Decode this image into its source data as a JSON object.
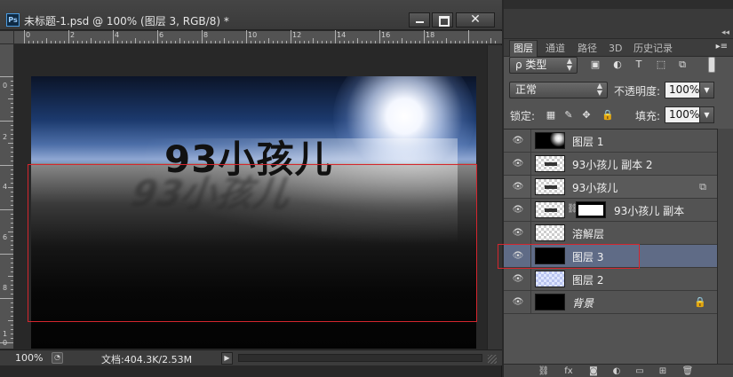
{
  "document": {
    "title": "未标题-1.psd @ 100% (图层 3, RGB/8) *",
    "app_badge": "Ps",
    "close_glyph": "✕",
    "zoom": "100%",
    "doc_info": "文档:404.3K/2.53M",
    "ruler_top_labels": [
      "0",
      "2",
      "4",
      "6",
      "8",
      "10",
      "12",
      "14",
      "16",
      "18"
    ],
    "ruler_left_labels": [
      "0",
      "2",
      "4",
      "6",
      "8",
      "1",
      "0"
    ],
    "canvas_text": "93小孩儿"
  },
  "panel": {
    "tabs": [
      {
        "label": "图层",
        "active": true
      },
      {
        "label": "通道",
        "active": false
      },
      {
        "label": "路径",
        "active": false
      },
      {
        "label": "3D",
        "active": false
      },
      {
        "label": "历史记录",
        "active": false
      }
    ],
    "filter_kind": "ρ 类型",
    "blend_mode": "正常",
    "opacity_label": "不透明度:",
    "opacity_value": "100%",
    "lock_label": "锁定:",
    "fill_label": "填充:",
    "fill_value": "100%",
    "layers": [
      {
        "name": "图层 1",
        "thumb": "glow",
        "selected": false
      },
      {
        "name": "93小孩儿 副本 2",
        "thumb": "checker txt",
        "selected": false
      },
      {
        "name": "93小孩儿",
        "thumb": "checker txt",
        "selected": false,
        "badge": "⧉"
      },
      {
        "name": "93小孩儿 副本",
        "thumb": "checker txt",
        "selected": false,
        "mask": true
      },
      {
        "name": "溶解层",
        "thumb": "checker",
        "selected": false
      },
      {
        "name": "图层 3",
        "thumb": "black strip",
        "selected": true
      },
      {
        "name": "图层 2",
        "thumb": "blue",
        "selected": false
      },
      {
        "name": "背景",
        "thumb": "black",
        "selected": false,
        "italic": true,
        "badge": "🔒"
      }
    ]
  },
  "colors": {
    "accent_red": "#d4262e",
    "selected_layer": "#5f6b86",
    "panel_bg": "#535353"
  },
  "icons": {
    "eye": "eye-icon",
    "lock": "lock-icon",
    "link": "link-icon",
    "fx": "fx-icon",
    "trash": "trash-icon"
  }
}
